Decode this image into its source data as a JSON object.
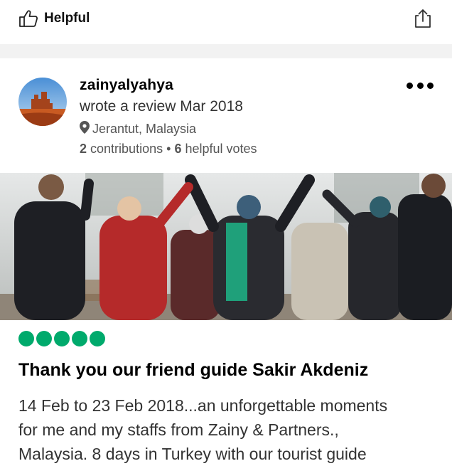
{
  "top_bar": {
    "helpful_label": "Helpful",
    "helpful_icon": "thumbs-up-icon",
    "share_icon": "share-icon"
  },
  "review": {
    "username": "zainyalyahya",
    "date_text": "wrote a review Mar 2018",
    "location": "Jerantut, Malaysia",
    "contributions_count": "2",
    "contributions_label": "contributions",
    "separator": "•",
    "helpful_votes_count": "6",
    "helpful_votes_label": "helpful votes",
    "rating": 5,
    "rating_max": 5,
    "title": "Thank you our friend guide Sakir Akdeniz",
    "body_lines": [
      "14 Feb to 23 Feb 2018...an unforgettable moments",
      "for me and my staffs from Zainy & Partners.,",
      "Malaysia. 8 days in Turkey with our tourist guide"
    ]
  },
  "colors": {
    "rating_bubble": "#00aa6c",
    "divider": "#f2f2f2"
  }
}
